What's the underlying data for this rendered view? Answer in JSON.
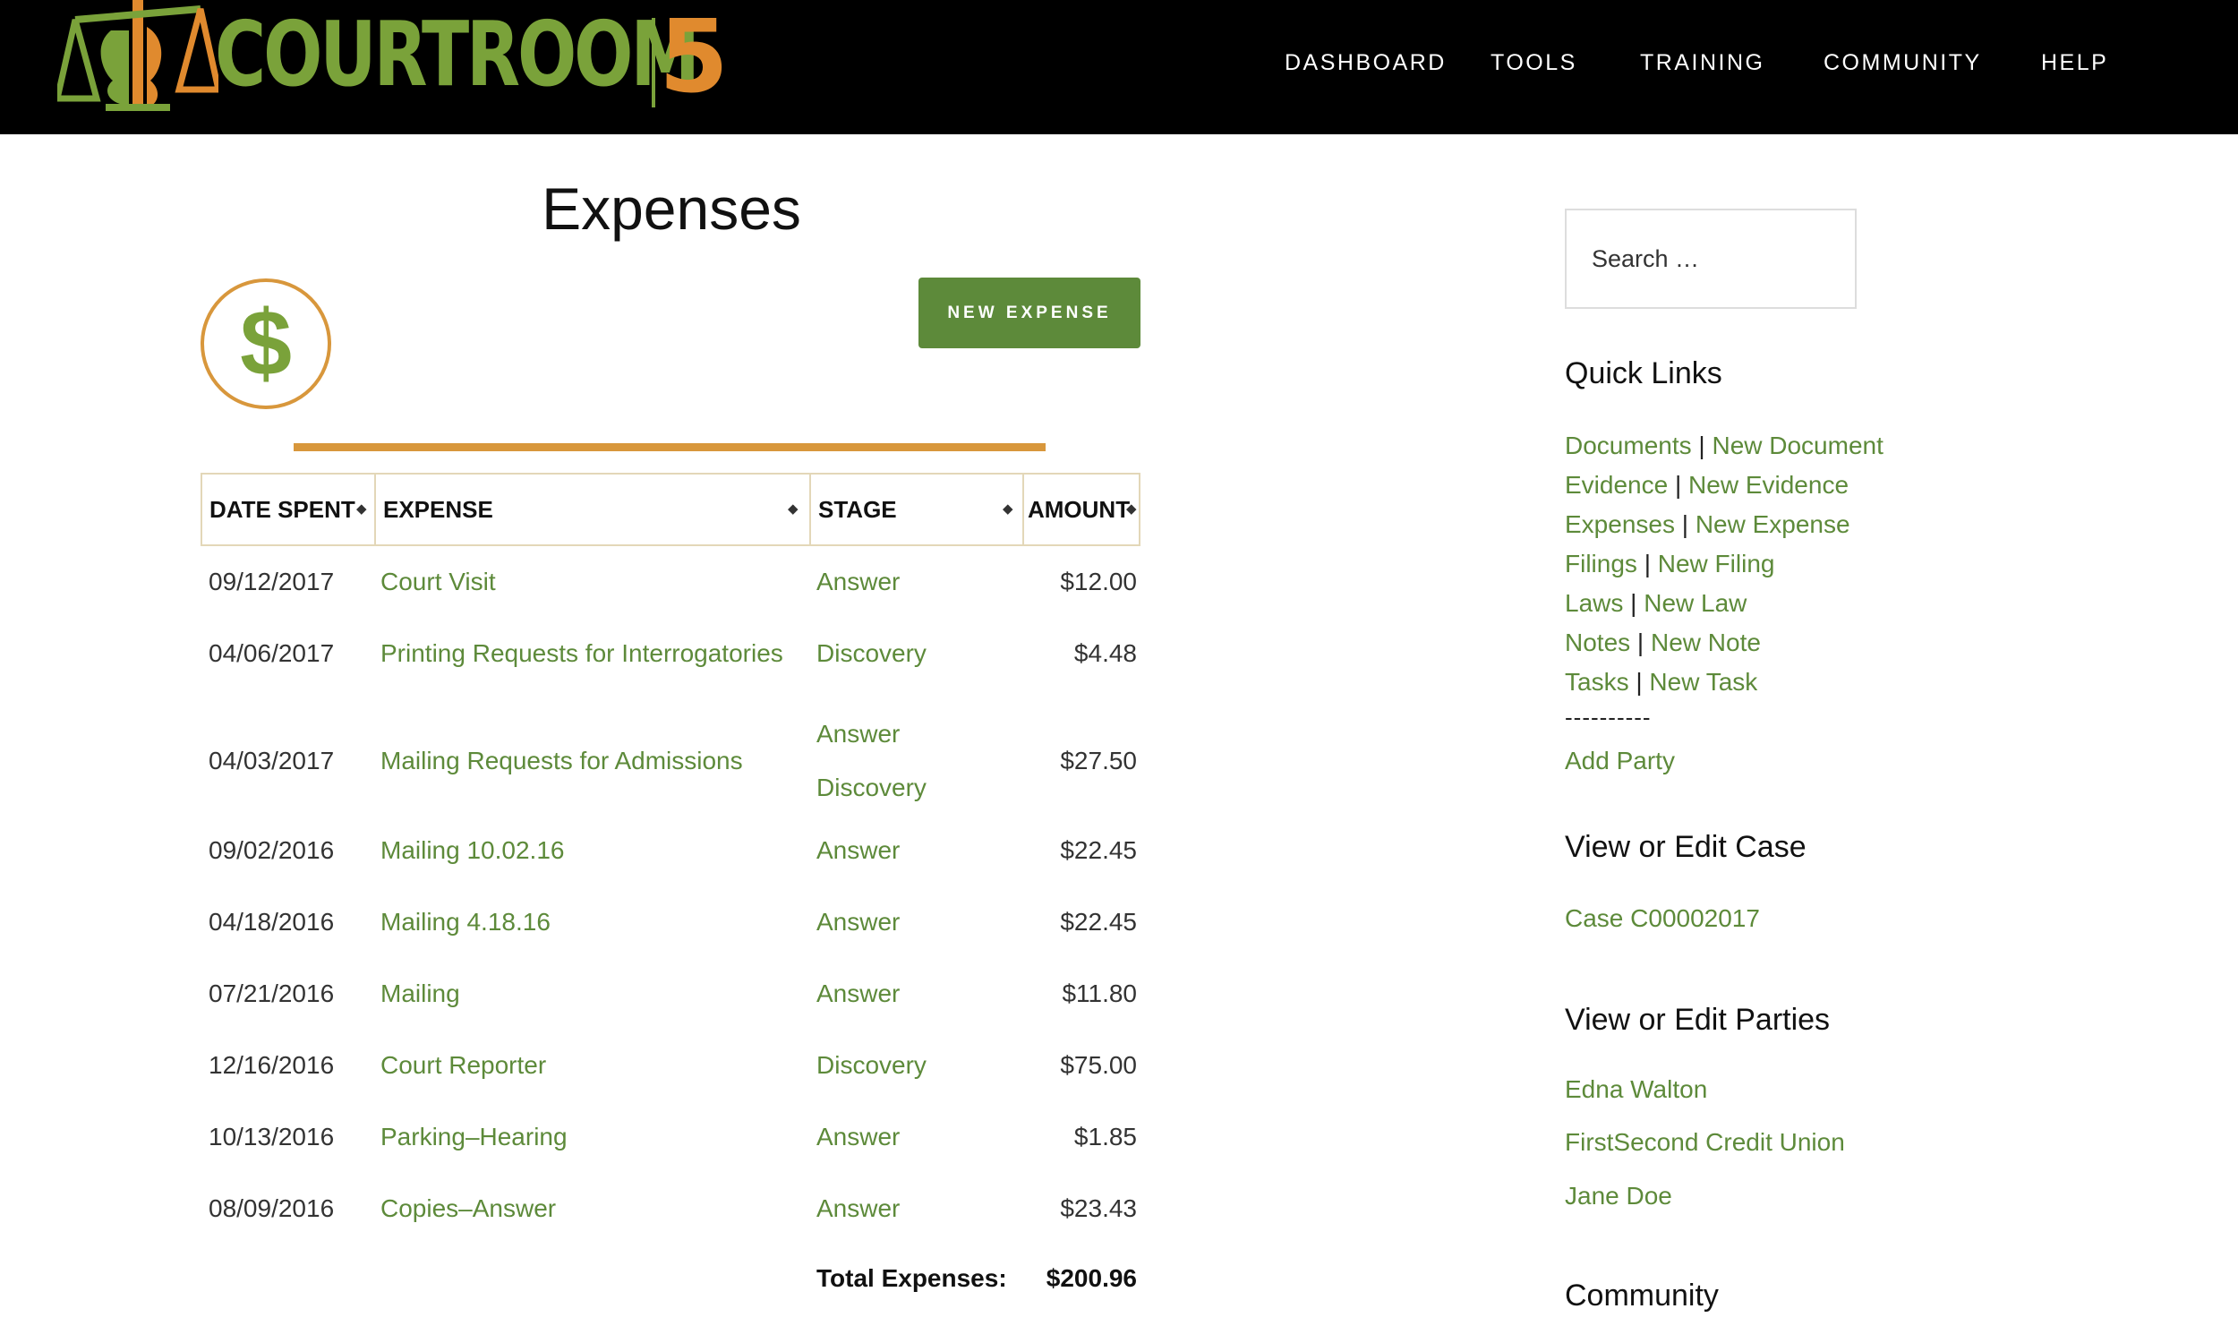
{
  "header": {
    "logo": {
      "word": "COURTROOM",
      "number": "5"
    },
    "nav": [
      "DASHBOARD",
      "TOOLS",
      "TRAINING",
      "COMMUNITY",
      "HELP"
    ]
  },
  "main": {
    "title": "Expenses",
    "new_expense_label": "NEW EXPENSE",
    "icon": "dollar-icon",
    "columns": [
      "DATE SPENT",
      "EXPENSE",
      "STAGE",
      "AMOUNT"
    ],
    "rows": [
      {
        "date": "09/12/2017",
        "expense": "Court Visit",
        "stages": [
          "Answer"
        ],
        "amount": "$12.00"
      },
      {
        "date": "04/06/2017",
        "expense": "Printing Requests for Interrogatories",
        "stages": [
          "Discovery"
        ],
        "amount": "$4.48"
      },
      {
        "date": "04/03/2017",
        "expense": "Mailing Requests for Admissions",
        "stages": [
          "Answer",
          "Discovery"
        ],
        "amount": "$27.50"
      },
      {
        "date": "09/02/2016",
        "expense": "Mailing 10.02.16",
        "stages": [
          "Answer"
        ],
        "amount": "$22.45"
      },
      {
        "date": "04/18/2016",
        "expense": "Mailing 4.18.16",
        "stages": [
          "Answer"
        ],
        "amount": "$22.45"
      },
      {
        "date": "07/21/2016",
        "expense": "Mailing",
        "stages": [
          "Answer"
        ],
        "amount": "$11.80"
      },
      {
        "date": "12/16/2016",
        "expense": "Court Reporter",
        "stages": [
          "Discovery"
        ],
        "amount": "$75.00"
      },
      {
        "date": "10/13/2016",
        "expense": "Parking–Hearing",
        "stages": [
          "Answer"
        ],
        "amount": "$1.85"
      },
      {
        "date": "08/09/2016",
        "expense": "Copies–Answer",
        "stages": [
          "Answer"
        ],
        "amount": "$23.43"
      }
    ],
    "total_label": "Total Expenses:",
    "total_value": "$200.96"
  },
  "sidebar": {
    "search_placeholder": "Search …",
    "quick_links_title": "Quick Links",
    "quick_links": [
      [
        "Documents",
        "New Document"
      ],
      [
        "Evidence",
        "New Evidence"
      ],
      [
        "Expenses",
        "New Expense"
      ],
      [
        "Filings",
        "New Filing"
      ],
      [
        "Laws",
        "New Law"
      ],
      [
        "Notes",
        "New Note"
      ],
      [
        "Tasks",
        "New Task"
      ]
    ],
    "separator": "----------",
    "add_party": "Add Party",
    "case_title": "View or Edit Case",
    "case_link": "Case C00002017",
    "parties_title": "View or Edit Parties",
    "parties": [
      "Edna Walton",
      "FirstSecond Credit Union",
      "Jane Doe"
    ],
    "community_title": "Community"
  },
  "colors": {
    "header_bg": "#000000",
    "accent_green": "#5d8a3a",
    "logo_green": "#7aa23a",
    "accent_orange": "#d8973c"
  }
}
